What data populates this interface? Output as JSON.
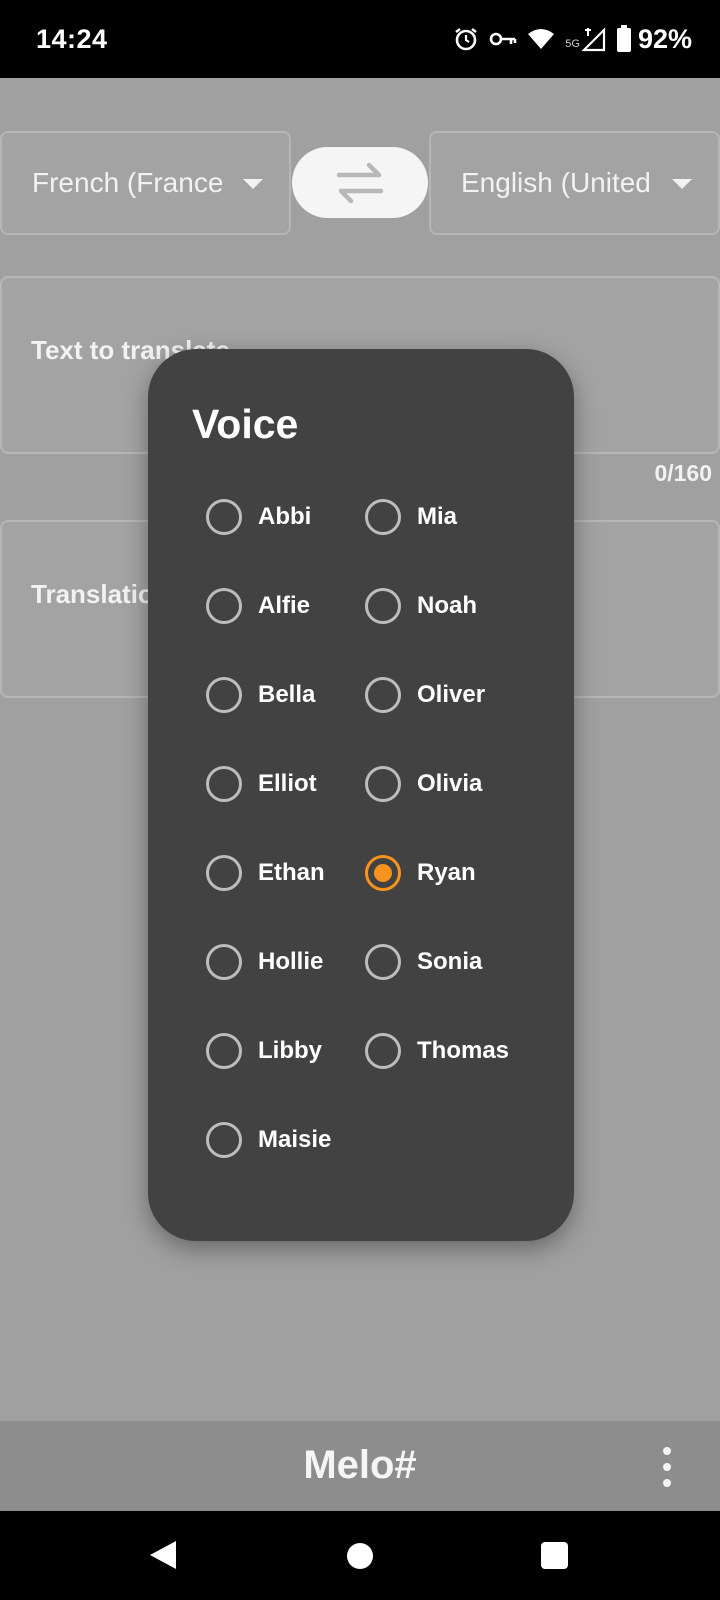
{
  "status_bar": {
    "time": "14:24",
    "network_label": "5G",
    "battery": "92%",
    "icons": [
      "alarm-icon",
      "vpn-key-icon",
      "wifi-icon",
      "cell-signal-icon",
      "battery-icon"
    ]
  },
  "languages": {
    "source": "French (France)",
    "target": "English (United States)"
  },
  "input": {
    "placeholder": "Text to translate",
    "counter": "0/160"
  },
  "output": {
    "placeholder": "Translation"
  },
  "bottom_bar": {
    "title": "Melo#"
  },
  "dialog": {
    "title": "Voice",
    "selected": "Ryan",
    "accent_color": "#f7931e",
    "voices_left": [
      "Abbi",
      "Alfie",
      "Bella",
      "Elliot",
      "Ethan",
      "Hollie",
      "Libby",
      "Maisie"
    ],
    "voices_right": [
      "Mia",
      "Noah",
      "Oliver",
      "Olivia",
      "Ryan",
      "Sonia",
      "Thomas"
    ]
  }
}
